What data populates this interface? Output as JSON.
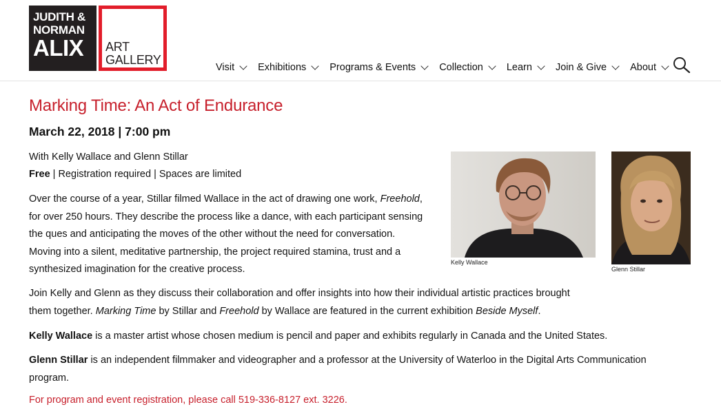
{
  "logo": {
    "line1": "JUDITH &",
    "line2": "NORMAN",
    "line3": "ALIX",
    "line4": "ART",
    "line5": "GALLERY"
  },
  "nav": {
    "items": [
      {
        "label": "Visit"
      },
      {
        "label": "Exhibitions"
      },
      {
        "label": "Programs & Events"
      },
      {
        "label": "Collection"
      },
      {
        "label": "Learn"
      },
      {
        "label": "Join & Give"
      },
      {
        "label": "About"
      }
    ],
    "search_icon": "search-icon"
  },
  "event": {
    "title": "Marking Time: An Act of Endurance",
    "date": "March 22, 2018 | 7:00 pm",
    "with": "With Kelly Wallace and Glenn Stillar",
    "free": "Free",
    "registration": " | Registration required | Spaces are limited",
    "p1_a": "Over the course of a year, Stillar filmed Wallace in the act of drawing one work, ",
    "p1_em": "Freehold",
    "p1_b": ", for over 250 hours. They describe the process like a dance, with each participant sensing the ques and anticipating the moves of the other without the need for conversation. Moving into a silent, meditative partnership, the project required stamina, trust and a synthesized imagination for the creative process.",
    "p2_a": "Join Kelly and Glenn as they discuss their collaboration and offer insights into how their individual artistic practices brought them together. ",
    "p2_em1": "Marking Time",
    "p2_b": " by Stillar and ",
    "p2_em2": "Freehold",
    "p2_c": " by Wallace are featured in the current exhibition ",
    "p2_em3": "Beside Myself",
    "p2_d": ".",
    "p3_name": "Kelly Wallace",
    "p3_text": " is a master artist whose chosen medium is pencil and paper and exhibits regularly in Canada and the United States.",
    "p4_name": "Glenn Stillar",
    "p4_text": " is an independent filmmaker and videographer and a professor at the University of Waterloo in the Digital Arts Communication program.",
    "contact": "For program and event registration, please call 519-336-8127 ext. 3226."
  },
  "photos": {
    "caption1": "Kelly Wallace",
    "caption2": "Glenn Stillar"
  },
  "colors": {
    "accent_red": "#c7202c",
    "logo_red": "#e21d2a",
    "logo_black": "#231f20"
  }
}
